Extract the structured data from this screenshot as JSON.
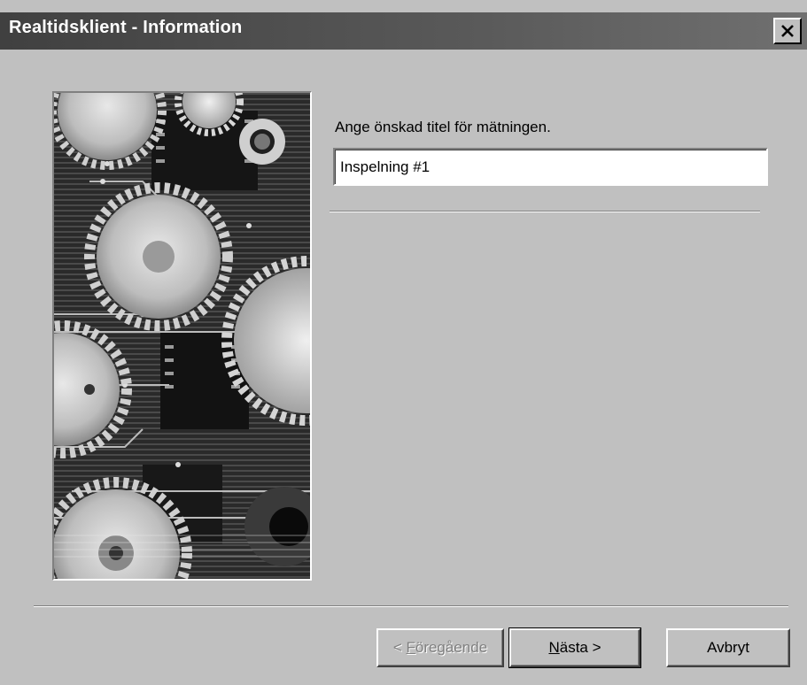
{
  "window": {
    "title": "Realtidsklient - Information"
  },
  "form": {
    "prompt": "Ange önskad titel för mätningen.",
    "title_value": "Inspelning #1"
  },
  "buttons": {
    "back": {
      "prefix": "< ",
      "mnemonic": "F",
      "rest": "öregående"
    },
    "next": {
      "mnemonic": "N",
      "rest": "ästa >"
    },
    "cancel": "Avbryt"
  },
  "icons": {
    "close": "close-icon",
    "image": "gears-circuit-image"
  }
}
